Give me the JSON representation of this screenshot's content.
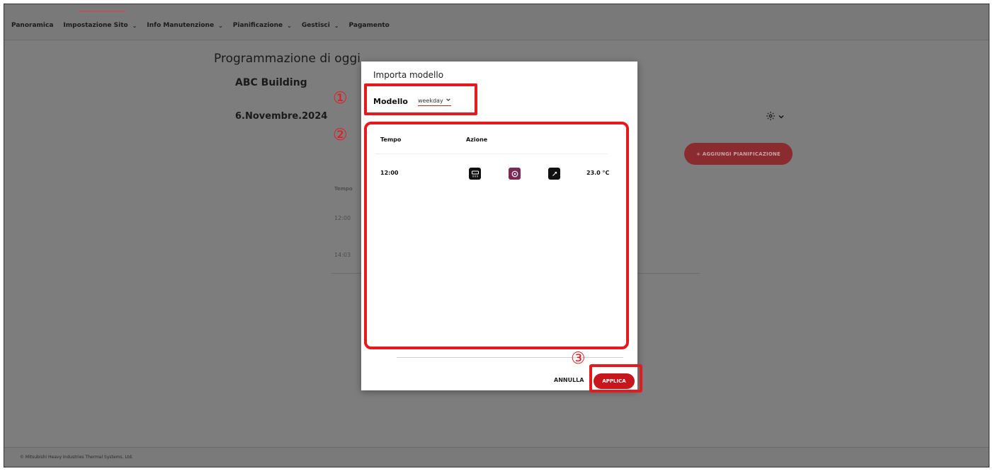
{
  "nav": {
    "items": [
      {
        "label": "Panoramica",
        "dropdown": false
      },
      {
        "label": "Impostazione Sito",
        "dropdown": true
      },
      {
        "label": "Info Manutenzione",
        "dropdown": true
      },
      {
        "label": "Pianificazione",
        "dropdown": true
      },
      {
        "label": "Gestisci",
        "dropdown": true
      },
      {
        "label": "Pagamento",
        "dropdown": false
      }
    ],
    "chevron": "⌄"
  },
  "page": {
    "title": "Programmazione di oggi",
    "site": "ABC Building",
    "date": "6.Novembre.2024",
    "add_button": "+ AGGIUNGI PIANIFICAZIONE",
    "table_head": "Tempo",
    "rows": [
      "12:00",
      "14:03"
    ]
  },
  "footer": {
    "copyright": "© Mitsubishi Heavy Industries Thermal Systems, Ltd."
  },
  "modal": {
    "title": "Importa modello",
    "model_label": "Modello",
    "model_value": "weekday",
    "table": {
      "headers": {
        "time": "Tempo",
        "action": "Azione"
      },
      "rows": [
        {
          "time": "12:00",
          "temperature": "23.0 °C"
        }
      ]
    },
    "cancel_label": "ANNULLA",
    "apply_label": "APPLICA"
  },
  "annotations": {
    "numbers": [
      "①",
      "②",
      "③"
    ],
    "color": "#e51a1f"
  },
  "colors": {
    "accent": "#c8161d",
    "overlay": "#7d7d7d"
  }
}
